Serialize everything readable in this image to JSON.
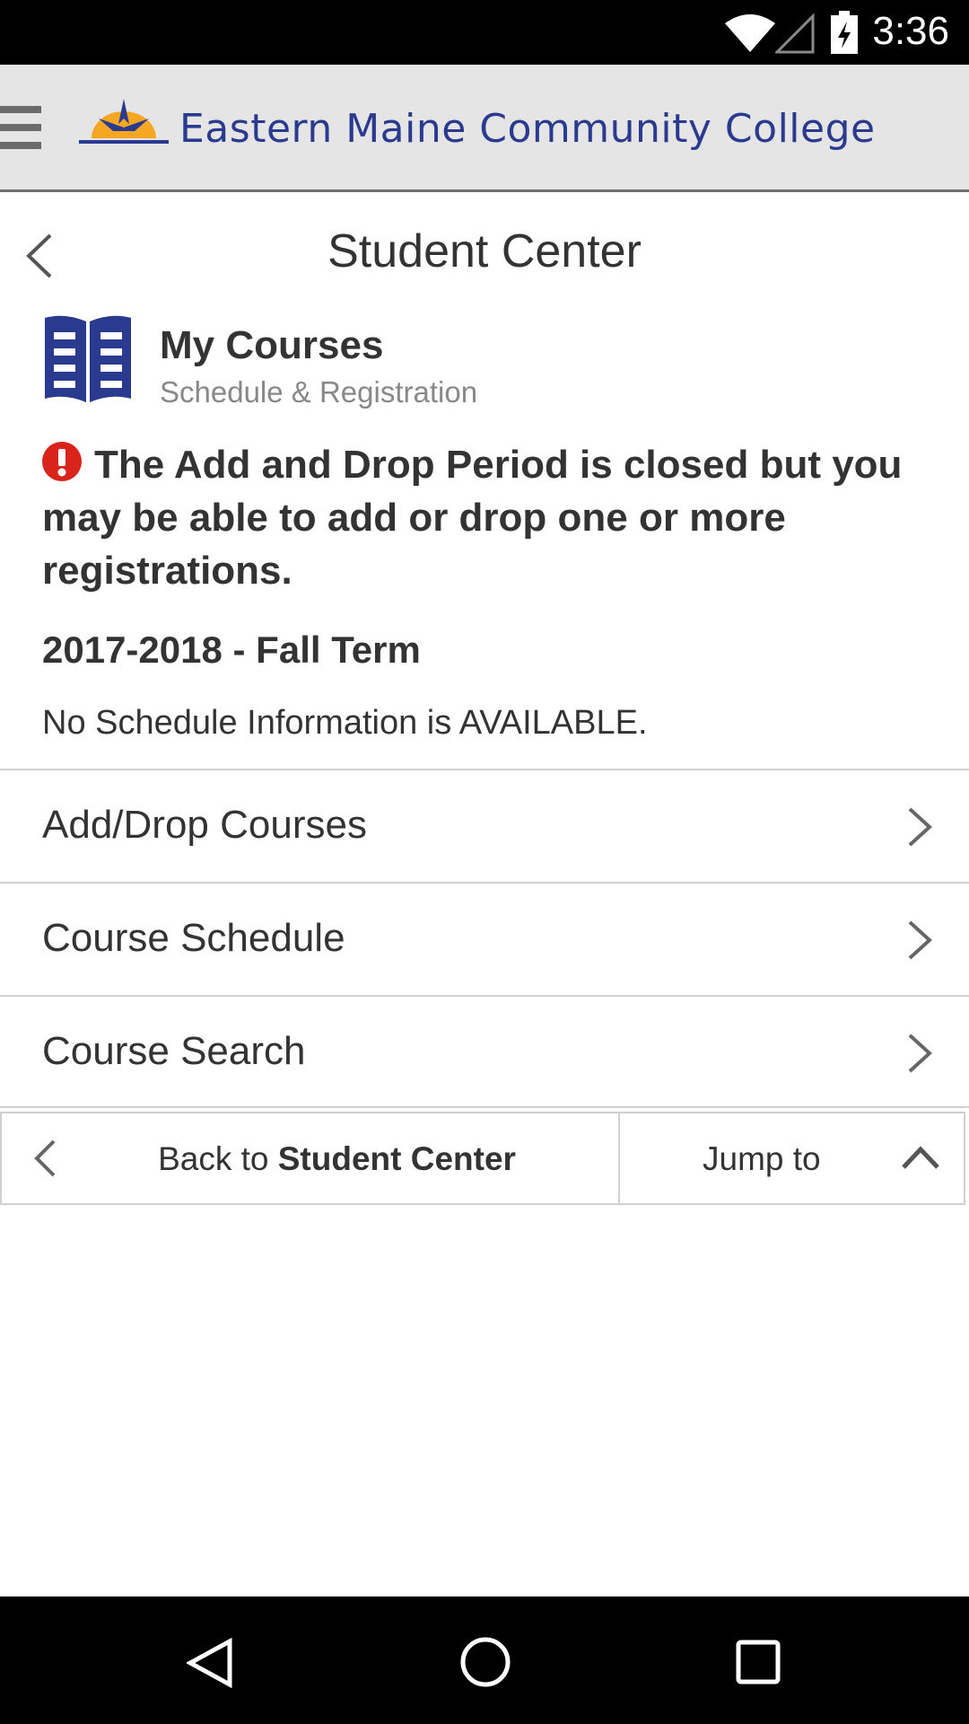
{
  "status_bar": {
    "time": "3:36"
  },
  "app_header": {
    "college_name": "Eastern Maine Community College"
  },
  "page": {
    "title": "Student Center"
  },
  "section": {
    "title": "My Courses",
    "subtitle": "Schedule & Registration"
  },
  "alert": {
    "message": "The Add and Drop Period is closed but you may be able to add or drop one or more registrations."
  },
  "term": {
    "name": "2017-2018 - Fall Term",
    "schedule_status": "No Schedule Information is AVAILABLE."
  },
  "menu": {
    "items": [
      {
        "label": "Add/Drop Courses"
      },
      {
        "label": "Course Schedule"
      },
      {
        "label": "Course Search"
      }
    ]
  },
  "footer": {
    "back_prefix": "Back to ",
    "back_target": "Student Center",
    "jump_label": "Jump to"
  },
  "colors": {
    "brand_blue": "#2a3a8e",
    "logo_orange": "#f5a623",
    "alert_red": "#d9241c"
  }
}
